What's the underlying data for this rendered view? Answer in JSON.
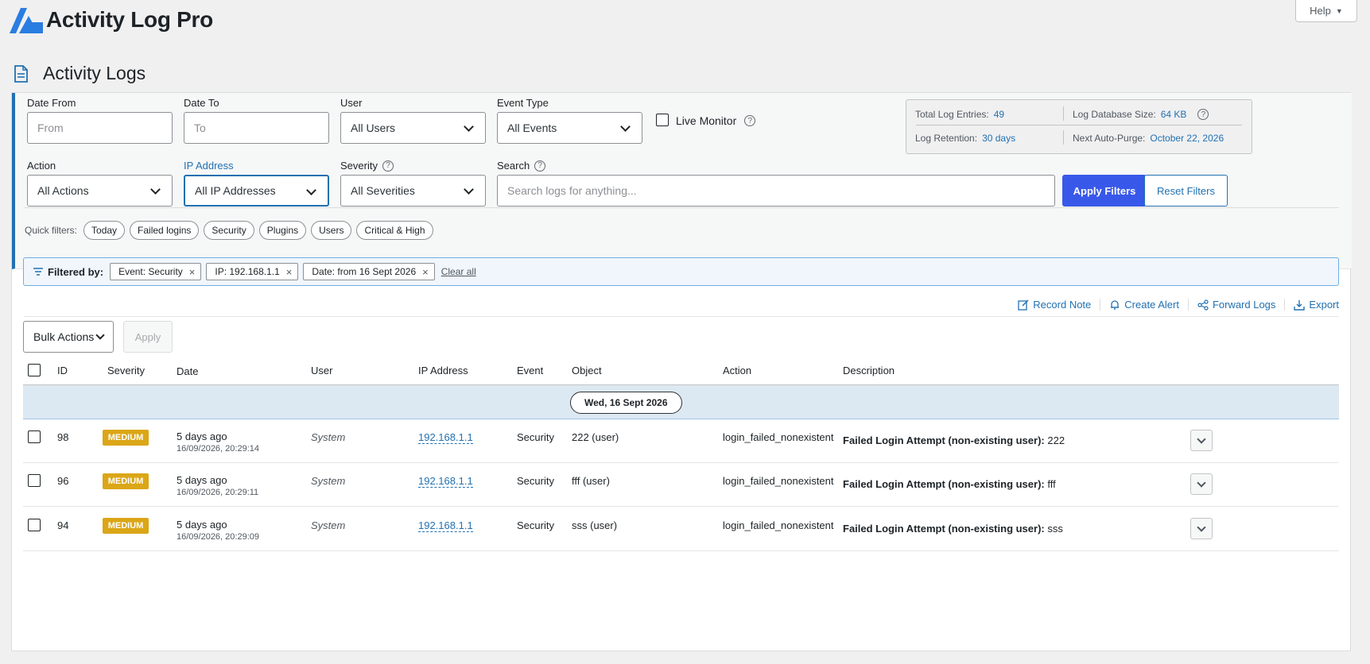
{
  "app": {
    "name": "Activity Log Pro",
    "logo_icon": "activity-log-pro-logo",
    "help_label": "Help"
  },
  "page": {
    "title": "Activity Logs",
    "icon": "document-icon"
  },
  "filters": {
    "date_from": {
      "label": "Date From",
      "placeholder": "From"
    },
    "date_to": {
      "label": "Date To",
      "placeholder": "To"
    },
    "user": {
      "label": "User",
      "value": "All Users"
    },
    "event_type": {
      "label": "Event Type",
      "value": "All Events"
    },
    "live_monitor": {
      "label": "Live Monitor",
      "checked": false
    },
    "action": {
      "label": "Action",
      "value": "All Actions"
    },
    "ip_address": {
      "label": "IP Address",
      "value": "All IP Addresses"
    },
    "severity": {
      "label": "Severity",
      "value": "All Severities"
    },
    "search": {
      "label": "Search",
      "placeholder": "Search logs for anything..."
    },
    "apply_label": "Apply Filters",
    "reset_label": "Reset Filters"
  },
  "stats": {
    "total_entries": {
      "label": "Total Log Entries:",
      "value": "49"
    },
    "db_size": {
      "label": "Log Database Size:",
      "value": "64 KB"
    },
    "retention": {
      "label": "Log Retention:",
      "value": "30 days"
    },
    "next_purge": {
      "label": "Next Auto-Purge:",
      "value": "October 22, 2026"
    }
  },
  "quick_filters": {
    "label": "Quick filters:",
    "chips": [
      "Today",
      "Failed logins",
      "Security",
      "Plugins",
      "Users",
      "Critical & High"
    ]
  },
  "active_filters": {
    "label": "Filtered by:",
    "tags": [
      "Event: Security",
      "IP: 192.168.1.1",
      "Date: from 16 Sept 2026"
    ],
    "clear_label": "Clear all"
  },
  "toolbar": {
    "record_note": "Record Note",
    "create_alert": "Create Alert",
    "forward_logs": "Forward Logs",
    "export": "Export",
    "bulk_actions": "Bulk Actions",
    "apply": "Apply"
  },
  "table": {
    "columns": [
      "ID",
      "Severity",
      "Date",
      "User",
      "IP Address",
      "Event",
      "Object",
      "Action",
      "Description"
    ],
    "group_date": "Wed, 16 Sept 2026",
    "rows": [
      {
        "id": "98",
        "severity": "MEDIUM",
        "date_rel": "5 days ago",
        "date_abs": "16/09/2026, 20:29:14",
        "user": "System",
        "ip": "192.168.1.1",
        "event": "Security",
        "object": "222 (user)",
        "action": "login_failed_nonexistent",
        "desc_bold": "Failed Login Attempt (non-existing user):",
        "desc_value": "222"
      },
      {
        "id": "96",
        "severity": "MEDIUM",
        "date_rel": "5 days ago",
        "date_abs": "16/09/2026, 20:29:11",
        "user": "System",
        "ip": "192.168.1.1",
        "event": "Security",
        "object": "fff (user)",
        "action": "login_failed_nonexistent",
        "desc_bold": "Failed Login Attempt (non-existing user):",
        "desc_value": "fff"
      },
      {
        "id": "94",
        "severity": "MEDIUM",
        "date_rel": "5 days ago",
        "date_abs": "16/09/2026, 20:29:09",
        "user": "System",
        "ip": "192.168.1.1",
        "event": "Security",
        "object": "sss (user)",
        "action": "login_failed_nonexistent",
        "desc_bold": "Failed Login Attempt (non-existing user):",
        "desc_value": "sss"
      }
    ]
  },
  "colors": {
    "accent": "#2271b1",
    "primary_button": "#3858e9",
    "medium_badge": "#dba617",
    "group_row": "#dce8f2"
  }
}
